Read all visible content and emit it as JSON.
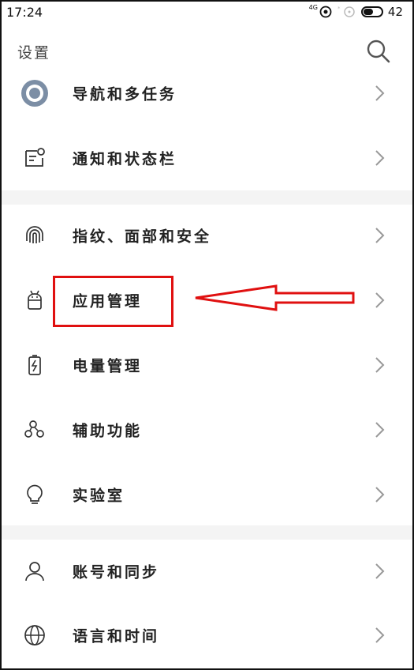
{
  "status_bar": {
    "time": "17:24",
    "network_label": "4G",
    "battery_level": "42"
  },
  "header": {
    "title": "设置",
    "search_icon": "search-icon"
  },
  "settings": {
    "items": [
      {
        "label": "导航和多任务",
        "icon": "navigation-icon"
      },
      {
        "label": "通知和状态栏",
        "icon": "notification-icon"
      },
      {
        "label": "指纹、面部和安全",
        "icon": "fingerprint-icon"
      },
      {
        "label": "应用管理",
        "icon": "android-icon"
      },
      {
        "label": "电量管理",
        "icon": "battery-icon"
      },
      {
        "label": "辅助功能",
        "icon": "accessibility-icon"
      },
      {
        "label": "实验室",
        "icon": "lightbulb-icon"
      },
      {
        "label": "账号和同步",
        "icon": "account-icon"
      },
      {
        "label": "语言和时间",
        "icon": "globe-icon"
      }
    ]
  },
  "annotation": {
    "highlight_color": "#e01010",
    "highlighted_item": "应用管理"
  }
}
